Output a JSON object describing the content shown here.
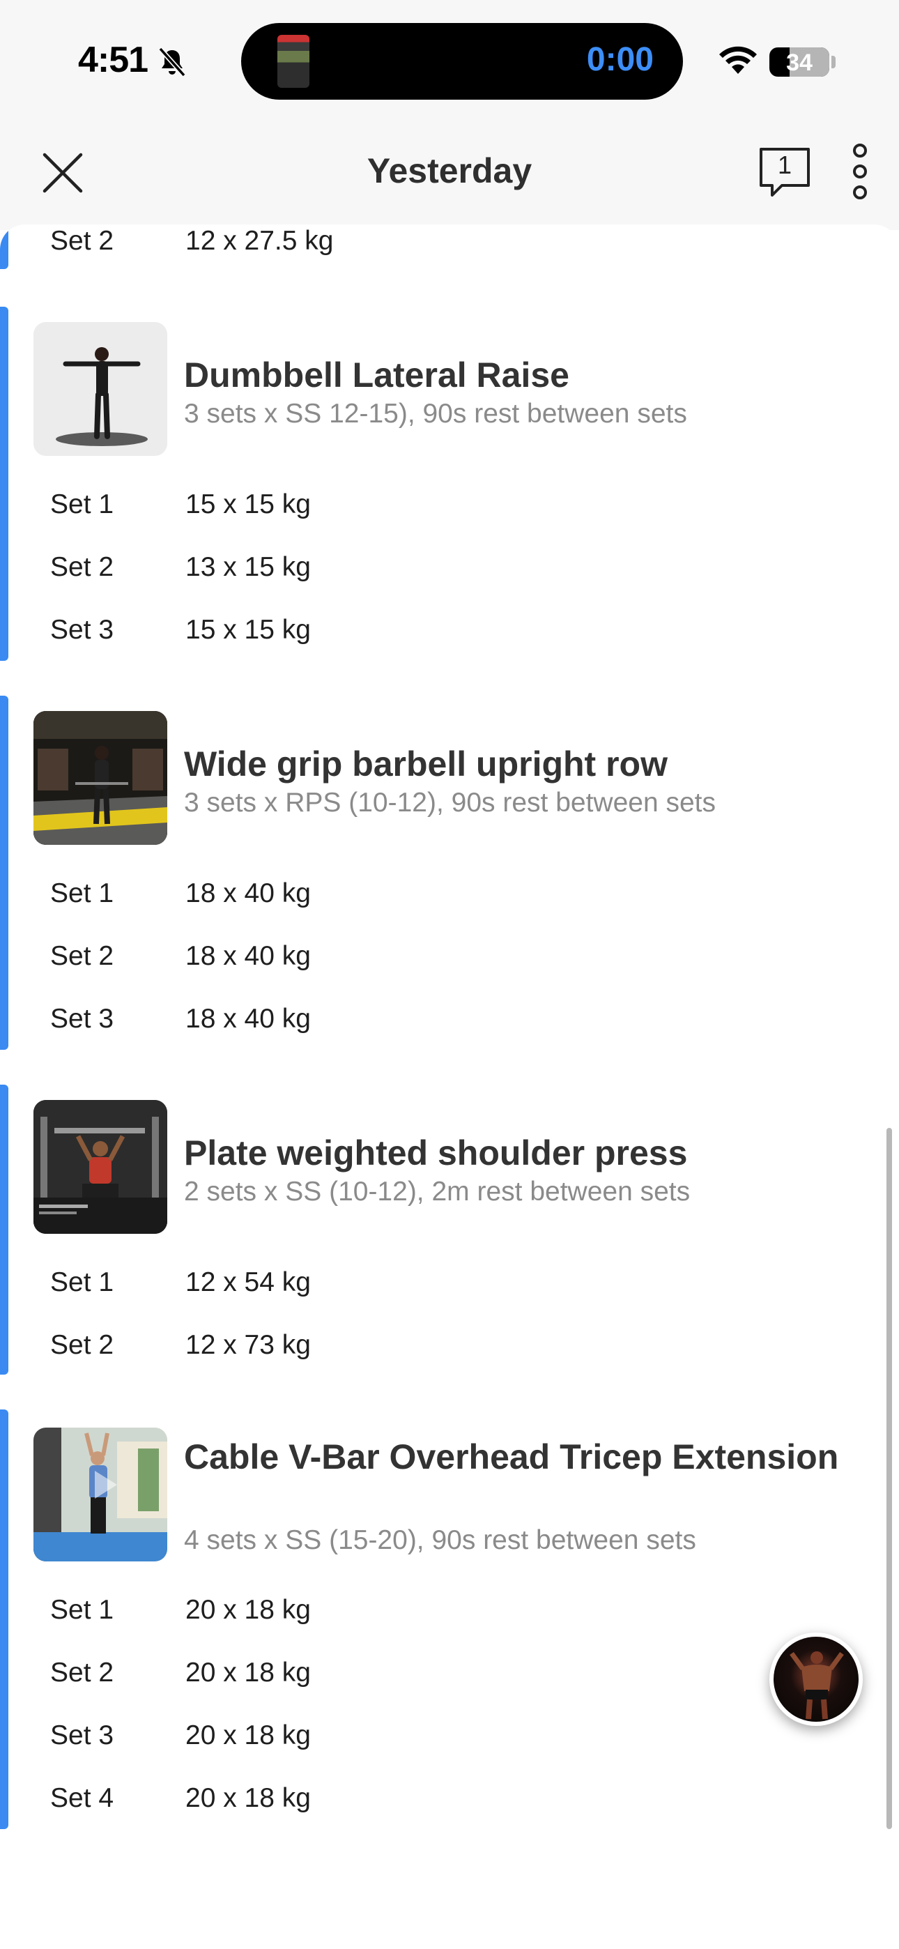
{
  "status_bar": {
    "time": "4:51",
    "live_activity_timer": "0:00",
    "battery_level": "34"
  },
  "nav": {
    "title": "Yesterday",
    "comment_count": "1"
  },
  "set_prefix": "Set",
  "previous_exercise_tail": {
    "sets": [
      {
        "label": "Set 2",
        "value": "12 x 27.5 kg"
      }
    ]
  },
  "exercises": [
    {
      "name": "Dumbbell Lateral Raise",
      "prescription": "3 sets x SS 12-15), 90s rest between sets",
      "thumbnail": "woman-lateral-raise-photo",
      "sets": [
        {
          "label": "Set 1",
          "value": "15 x 15 kg"
        },
        {
          "label": "Set 2",
          "value": "13 x 15 kg"
        },
        {
          "label": "Set 3",
          "value": "15 x 15 kg"
        }
      ]
    },
    {
      "name": "Wide grip barbell upright row",
      "prescription": "3 sets x RPS (10-12), 90s rest between sets",
      "thumbnail": "gym-upright-row-photo",
      "sets": [
        {
          "label": "Set 1",
          "value": "18 x 40 kg"
        },
        {
          "label": "Set 2",
          "value": "18 x 40 kg"
        },
        {
          "label": "Set 3",
          "value": "18 x 40 kg"
        }
      ]
    },
    {
      "name": "Plate weighted shoulder press",
      "prescription": "2 sets x SS (10-12), 2m rest between sets",
      "thumbnail": "shoulder-press-photo",
      "sets": [
        {
          "label": "Set 1",
          "value": "12 x 54 kg"
        },
        {
          "label": "Set 2",
          "value": "12 x 73 kg"
        }
      ]
    },
    {
      "name": "Cable V-Bar Overhead Tricep Extension",
      "prescription": "4 sets x SS (15-20), 90s rest between sets",
      "thumbnail": "tricep-extension-video",
      "sets": [
        {
          "label": "Set 1",
          "value": "20 x 18 kg"
        },
        {
          "label": "Set 2",
          "value": "20 x 18 kg"
        },
        {
          "label": "Set 3",
          "value": "20 x 18 kg"
        },
        {
          "label": "Set 4",
          "value": "20 x 18 kg"
        }
      ]
    }
  ],
  "colors": {
    "accent": "#3a8af2",
    "timer": "#3d8ef7",
    "title_text": "#333333",
    "secondary_text": "#8a8a8a"
  },
  "icons": {
    "close": "close-icon",
    "comments": "comment-icon",
    "more": "more-vertical-icon",
    "coach": "coach-avatar"
  }
}
